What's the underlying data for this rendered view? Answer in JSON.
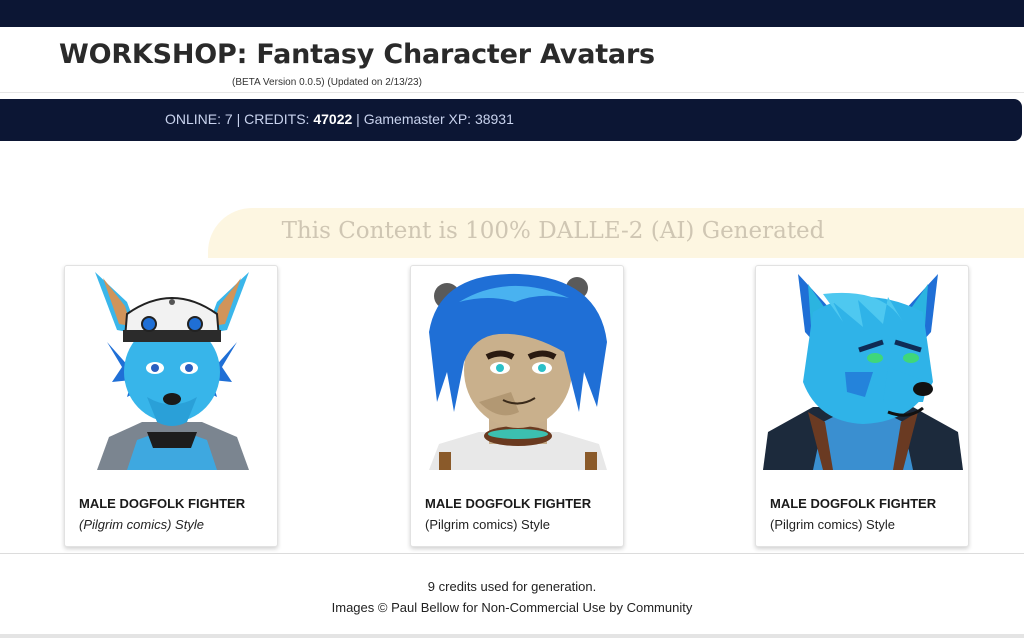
{
  "header": {
    "title": "WORKSHOP: Fantasy Character Avatars",
    "version": "(BETA Version 0.0.5) (Updated on 2/13/23)"
  },
  "stats": {
    "online_label": "ONLINE: 7 | CREDITS: ",
    "credits": "47022",
    "xp_label": " | Gamemaster XP: 38931"
  },
  "banner": {
    "text": "This Content is 100% DALLE-2 (AI) Generated"
  },
  "cards": [
    {
      "title": "MALE DOGFOLK FIGHTER",
      "style": "(Pilgrim comics) Style"
    },
    {
      "title": "MALE DOGFOLK FIGHTER",
      "style": "(Pilgrim comics) Style"
    },
    {
      "title": "MALE DOGFOLK FIGHTER",
      "style": "(Pilgrim comics) Style"
    }
  ],
  "footer": {
    "credits_used": "9 credits used for generation.",
    "copyright": "Images © Paul Bellow for Non-Commercial Use by Community"
  },
  "colors": {
    "nav_bg": "#0c1634",
    "banner_bg": "#fdf6e1",
    "banner_text": "#cfc6b3",
    "avatar_blue": "#2fb3e8",
    "avatar_hair": "#1f6fd6"
  },
  "icons": [
    "dogfolk-avatar-1-image",
    "dogfolk-avatar-2-image",
    "dogfolk-avatar-3-image"
  ]
}
